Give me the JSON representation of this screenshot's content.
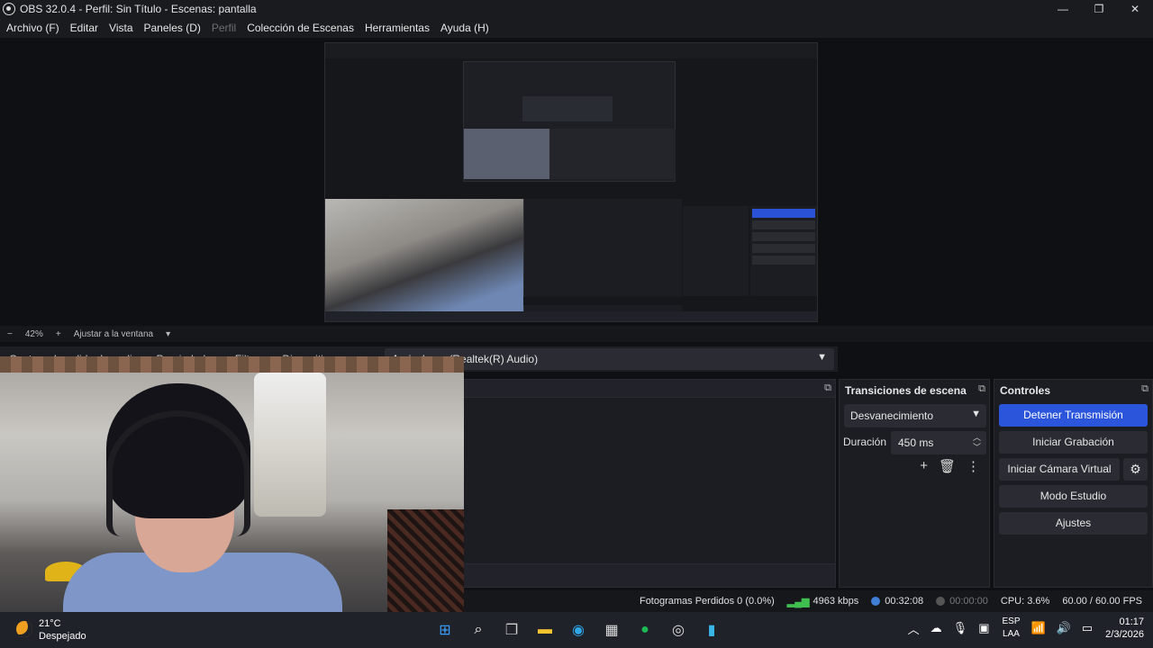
{
  "window": {
    "title": "OBS 32.0.4 - Perfil: Sin Título - Escenas: pantalla",
    "controls": {
      "minimize": "—",
      "maximize": "❐",
      "close": "✕"
    }
  },
  "menu": {
    "archivo": "Archivo (F)",
    "editar": "Editar",
    "vista": "Vista",
    "paneles": "Paneles (D)",
    "perfil": "Perfil",
    "coleccion": "Colección de Escenas",
    "herramientas": "Herramientas",
    "ayuda": "Ayuda (H)"
  },
  "preview": {
    "zoom_out": "−",
    "zoom_level": "42%",
    "zoom_in": "+",
    "fit_label": "Ajustar a la ventana",
    "fit_chevron": "▾"
  },
  "source_bar": {
    "audio_capture": "Captura de salida de audio",
    "properties": "Propiedades",
    "filters": "Filtros",
    "device_label": "Dispositivo",
    "device_value": "Auriculares (Realtek(R) Audio)"
  },
  "transitions": {
    "title": "Transiciones de escena",
    "selected": "Desvanecimiento",
    "duration_label": "Duración",
    "duration_value": "450 ms"
  },
  "controls": {
    "title": "Controles",
    "stop_stream": "Detener Transmisión",
    "start_record": "Iniciar Grabación",
    "virtual_cam": "Iniciar Cámara Virtual",
    "studio_mode": "Modo Estudio",
    "settings": "Ajustes"
  },
  "status": {
    "dropped_frames": "Fotogramas Perdidos 0 (0.0%)",
    "bitrate": "4963 kbps",
    "stream_time": "00:32:08",
    "record_time": "00:00:00",
    "cpu": "CPU: 3.6%",
    "fps": "60.00 / 60.00 FPS"
  },
  "taskbar": {
    "temperature": "21°C",
    "weather": "Despejado",
    "lang_top": "ESP",
    "lang_bottom": "LAA",
    "time": "01:17",
    "date": "2/3/2026"
  },
  "colors": {
    "accent": "#2b55db",
    "panel": "#1c1d22",
    "background": "#0f1014",
    "bitrate_green": "#3fbf4f"
  }
}
